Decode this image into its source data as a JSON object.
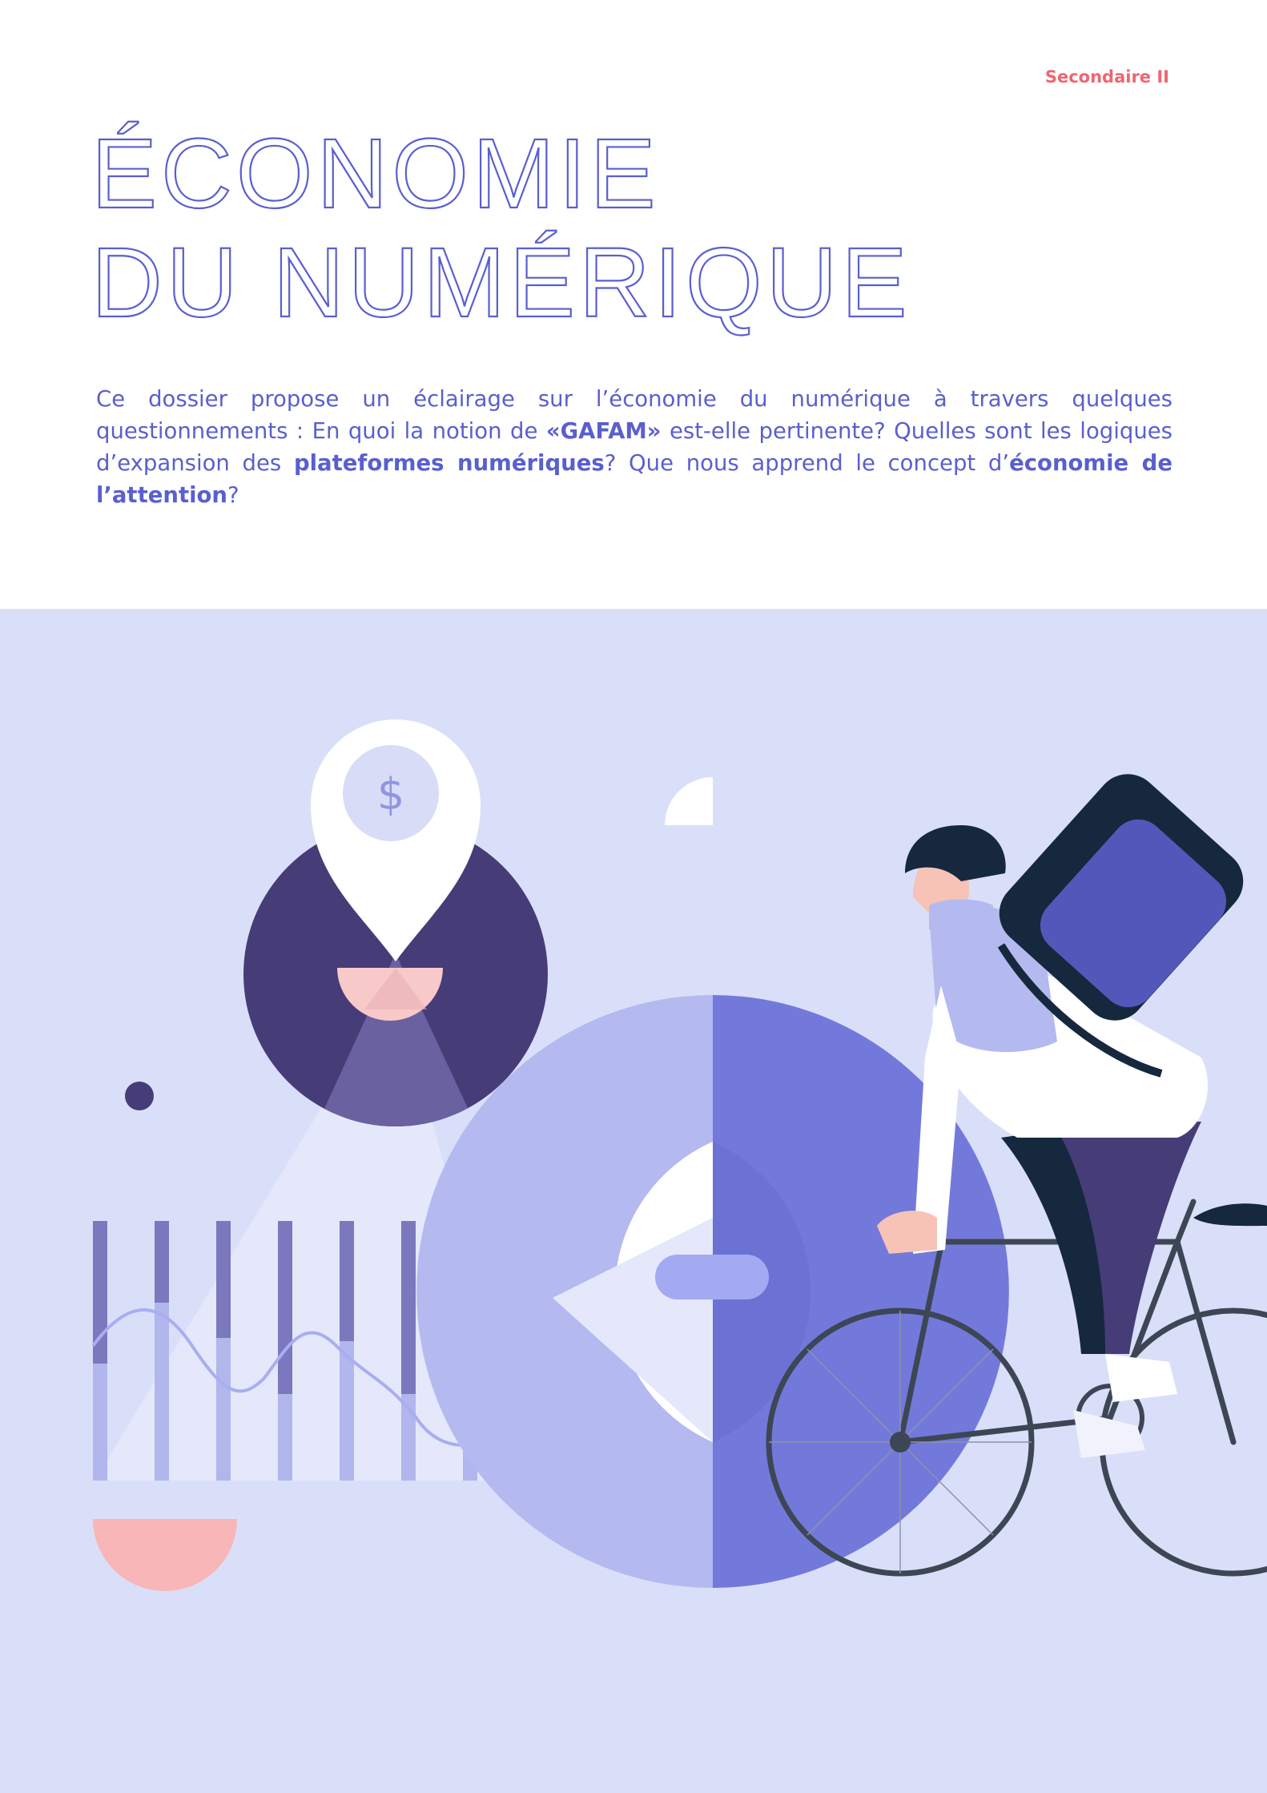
{
  "header": {
    "level_label": "Secondaire II"
  },
  "title": {
    "line1": "ÉCONOMIE",
    "line2": "DU NUMÉRIQUE"
  },
  "intro": {
    "part1": "Ce dossier propose un éclairage sur l’économie du numérique à travers quelques questionnements : En quoi la notion de ",
    "gafam": "«GAFAM»",
    "part2": " est-elle pertinente? Quelles sont les logiques d’expansion des ",
    "platforms": "plateformes numériques",
    "part3": "? Que nous apprend le concept d’",
    "attention": "économie de l’attention",
    "part4": "?"
  },
  "illustration": {
    "pin_symbol": "$",
    "icons": [
      "location-pin-icon",
      "dollar-icon",
      "cyclist-icon",
      "bicycle-icon",
      "delivery-backpack-icon"
    ],
    "colors": {
      "background": "#dadff9",
      "dark_purple": "#463c78",
      "blue": "#7279d8",
      "pink": "#f8b6b8",
      "navy": "#15283d"
    }
  }
}
